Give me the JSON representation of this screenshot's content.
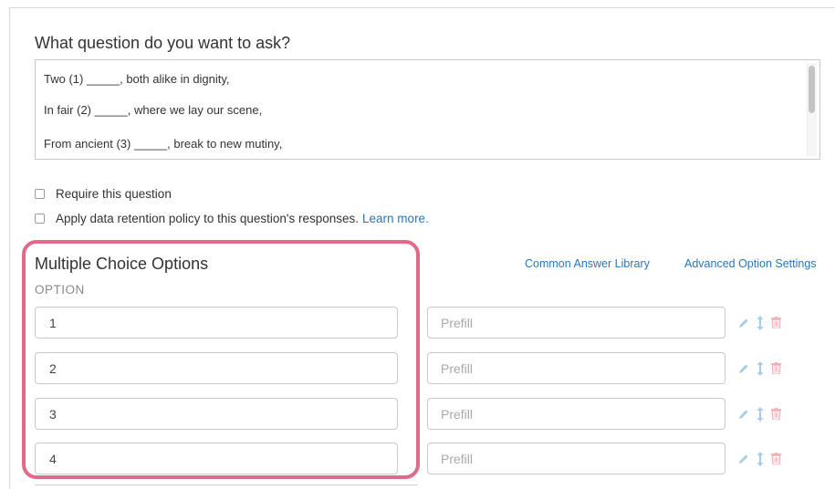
{
  "question": {
    "label": "What question do you want to ask?",
    "lines": [
      "Two (1) _____, both alike in dignity,",
      "In fair (2) _____, where we lay our scene,",
      "From ancient (3) _____, break to new mutiny,"
    ]
  },
  "checks": {
    "require_label": "Require this question",
    "retention_label": "Apply data retention policy to this question's responses.",
    "learn_more": "Learn more."
  },
  "options_section": {
    "title": "Multiple Choice Options",
    "column_header": "OPTION",
    "common_answer_library": "Common Answer Library",
    "advanced_option_settings": "Advanced Option Settings",
    "prefill_placeholder": "Prefill",
    "options": [
      {
        "value": "1"
      },
      {
        "value": "2"
      },
      {
        "value": "3"
      },
      {
        "value": "4"
      }
    ]
  },
  "colors": {
    "highlight": "#e06a8a",
    "link": "#2a76b8",
    "icon": "#a9cce6",
    "trash": "#efb3b8"
  }
}
